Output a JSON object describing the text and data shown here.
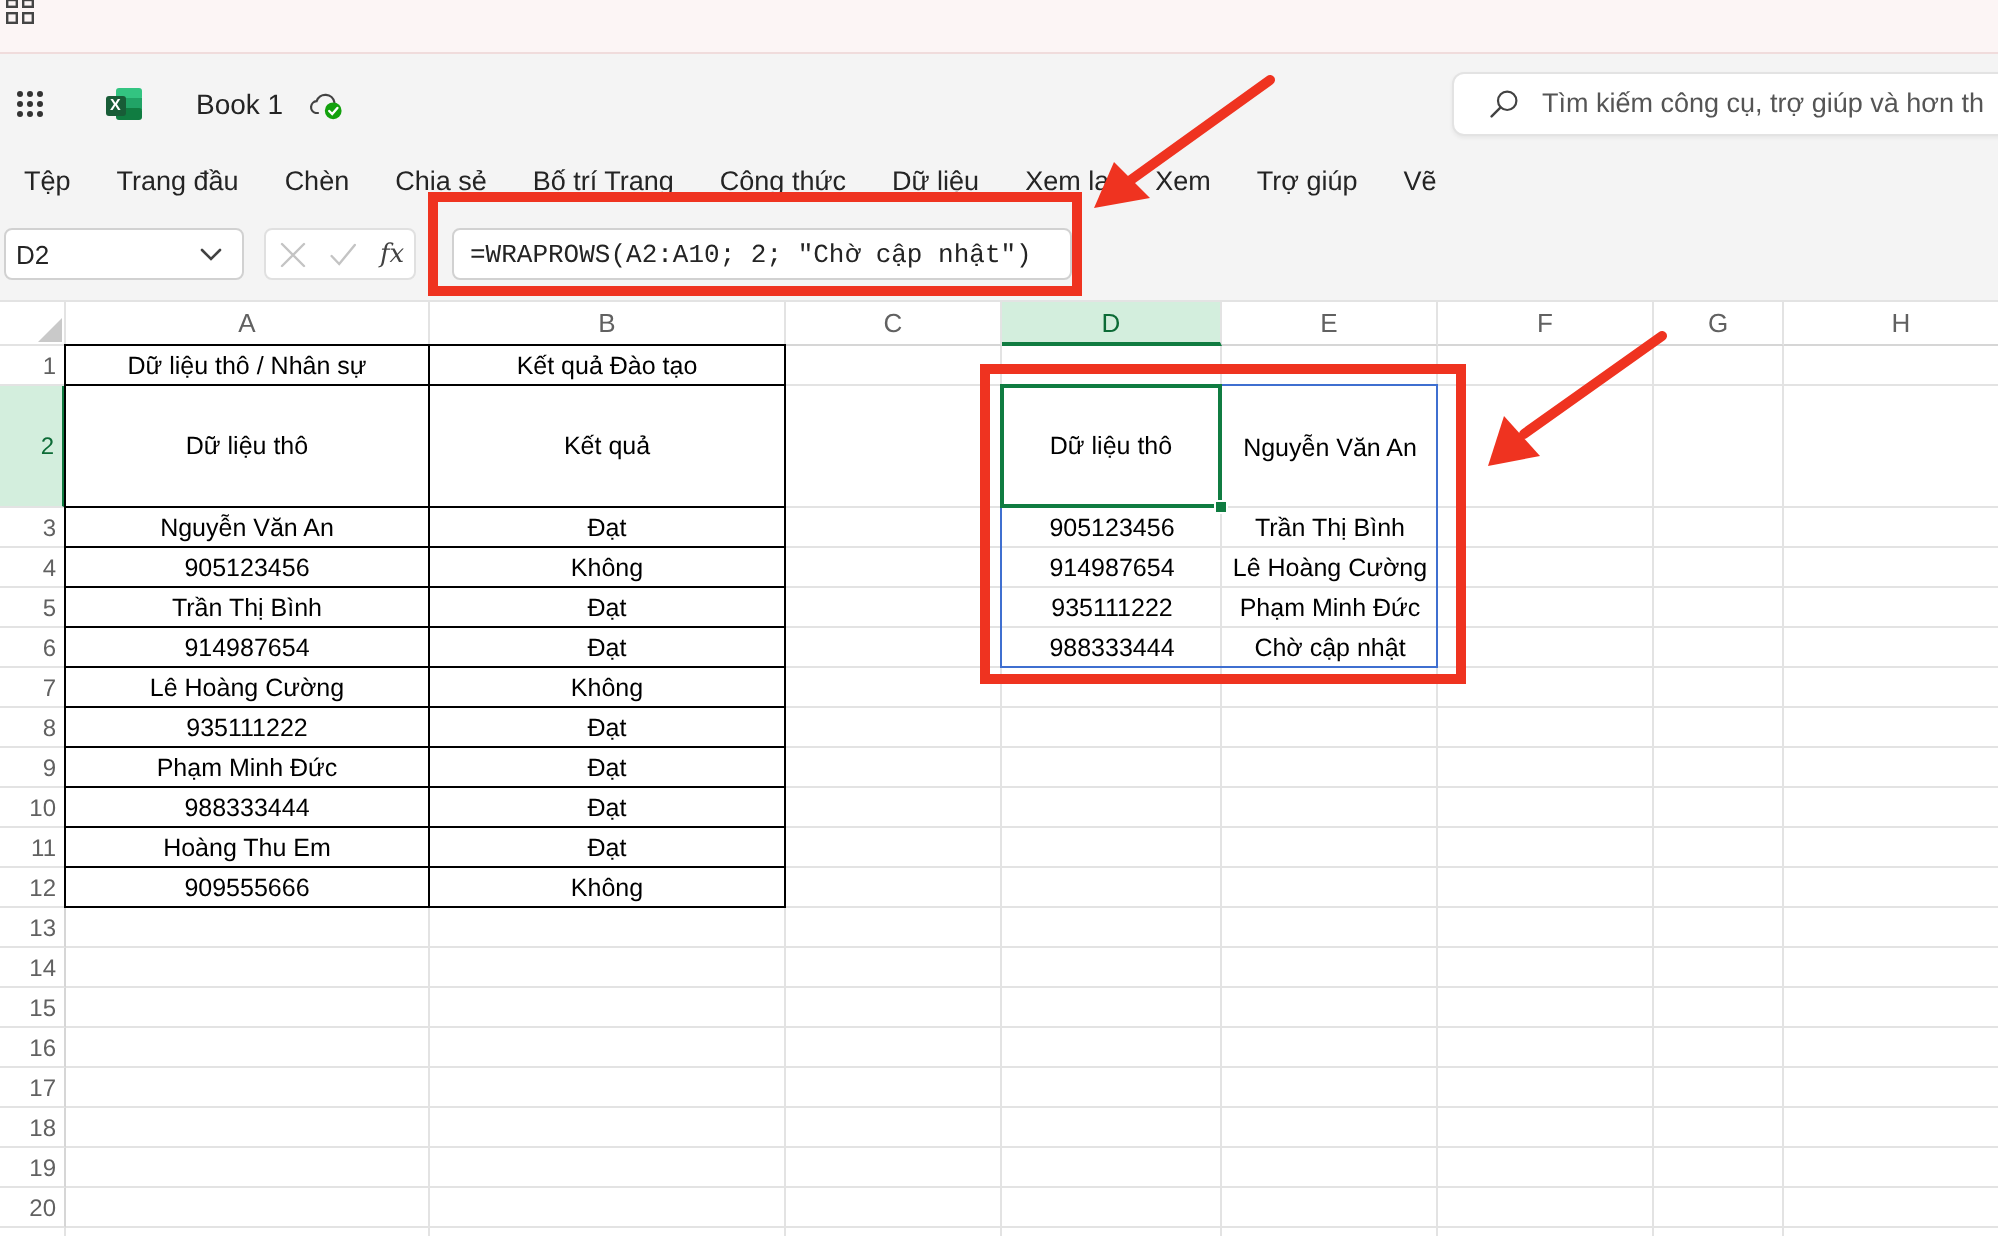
{
  "app_bar": {
    "logo_letter": "X",
    "document_title": "Book 1",
    "search": {
      "placeholder": "Tìm kiếm công cụ, trợ giúp và hơn th"
    }
  },
  "ribbon_tabs": [
    {
      "label": "Tệp",
      "selected": false
    },
    {
      "label": "Trang đầu",
      "selected": false
    },
    {
      "label": "Chèn",
      "selected": false
    },
    {
      "label": "Chia sẻ",
      "selected": false
    },
    {
      "label": "Bố trí Trang",
      "selected": false
    },
    {
      "label": "Công thức",
      "selected": false
    },
    {
      "label": "Dữ liệu",
      "selected": false
    },
    {
      "label": "Xem la",
      "selected": false
    },
    {
      "label": "Xem",
      "selected": false
    },
    {
      "label": "Trợ giúp",
      "selected": false
    },
    {
      "label": "Vẽ",
      "selected": false
    }
  ],
  "formula_bar": {
    "name_box": "D2",
    "actions": [
      {
        "kind": "cancel",
        "disabled": true
      },
      {
        "kind": "enter",
        "disabled": true
      }
    ],
    "function_button": "fx",
    "formula": "=WRAPROWS(A2:A10; 2; \"Chờ cập nhật\")"
  },
  "sheet": {
    "columns": [
      {
        "label": "A",
        "selected": false
      },
      {
        "label": "B",
        "selected": false
      },
      {
        "label": "C",
        "selected": false
      },
      {
        "label": "D",
        "selected": true
      },
      {
        "label": "E",
        "selected": false
      },
      {
        "label": "F",
        "selected": false
      },
      {
        "label": "G",
        "selected": false
      },
      {
        "label": "H",
        "selected": false
      }
    ],
    "rows": [
      {
        "label": "1",
        "selected": false
      },
      {
        "label": "2",
        "selected": true
      },
      {
        "label": "3",
        "selected": false
      },
      {
        "label": "4",
        "selected": false
      },
      {
        "label": "5",
        "selected": false
      },
      {
        "label": "6",
        "selected": false
      },
      {
        "label": "7",
        "selected": false
      },
      {
        "label": "8",
        "selected": false
      },
      {
        "label": "9",
        "selected": false
      },
      {
        "label": "10",
        "selected": false
      },
      {
        "label": "11",
        "selected": false
      },
      {
        "label": "12",
        "selected": false
      },
      {
        "label": "13",
        "selected": false
      },
      {
        "label": "14",
        "selected": false
      },
      {
        "label": "15",
        "selected": false
      },
      {
        "label": "16",
        "selected": false
      },
      {
        "label": "17",
        "selected": false
      },
      {
        "label": "18",
        "selected": false
      },
      {
        "label": "19",
        "selected": false
      },
      {
        "label": "20",
        "selected": false
      }
    ],
    "table": [
      [
        "Dữ liệu thô / Nhân sự",
        "Kết quả Đào tạo"
      ],
      [
        "Dữ liệu thô",
        "Kết quả"
      ],
      [
        "Nguyễn Văn An",
        "Đạt"
      ],
      [
        "905123456",
        "Không"
      ],
      [
        "Trần Thị Bình",
        "Đạt"
      ],
      [
        "914987654",
        "Đạt"
      ],
      [
        "Lê Hoàng Cường",
        "Không"
      ],
      [
        "935111222",
        "Đạt"
      ],
      [
        "Phạm Minh Đức",
        "Đạt"
      ],
      [
        "988333444",
        "Đạt"
      ],
      [
        "Hoàng Thu Em",
        "Đạt"
      ],
      [
        "909555666",
        "Không"
      ]
    ],
    "spill": [
      [
        {
          "text": "Dữ liệu thô",
          "selected": true
        },
        {
          "text": "Nguyễn Văn An",
          "selected": false
        }
      ],
      [
        {
          "text": "905123456",
          "selected": false
        },
        {
          "text": "Trần Thị Bình",
          "selected": false
        }
      ],
      [
        {
          "text": "914987654",
          "selected": false
        },
        {
          "text": "Lê Hoàng Cường",
          "selected": false
        }
      ],
      [
        {
          "text": "935111222",
          "selected": false
        },
        {
          "text": "Phạm Minh Đức",
          "selected": false
        }
      ],
      [
        {
          "text": "988333444",
          "selected": false
        },
        {
          "text": "Chờ cập nhật",
          "selected": false
        }
      ]
    ]
  }
}
